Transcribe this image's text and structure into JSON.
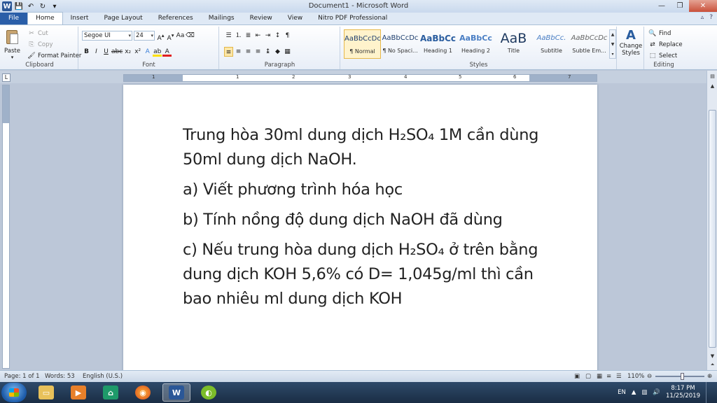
{
  "window": {
    "title": "Document1 - Microsoft Word"
  },
  "tabs": [
    "File",
    "Home",
    "Insert",
    "Page Layout",
    "References",
    "Mailings",
    "Review",
    "View",
    "Nitro PDF Professional"
  ],
  "clipboard": {
    "paste": "Paste",
    "cut": "Cut",
    "copy": "Copy",
    "format_painter": "Format Painter",
    "label": "Clipboard"
  },
  "font": {
    "family": "Segoe UI",
    "size": "24",
    "label": "Font"
  },
  "paragraph": {
    "label": "Paragraph"
  },
  "styles": {
    "items": [
      {
        "sample": "AaBbCcDc",
        "name": "¶ Normal"
      },
      {
        "sample": "AaBbCcDc",
        "name": "¶ No Spaci..."
      },
      {
        "sample": "AaBbCc",
        "name": "Heading 1"
      },
      {
        "sample": "AaBbCc",
        "name": "Heading 2"
      },
      {
        "sample": "AaB",
        "name": "Title"
      },
      {
        "sample": "AaBbCc.",
        "name": "Subtitle"
      },
      {
        "sample": "AaBbCcDc",
        "name": "Subtle Em..."
      }
    ],
    "change_styles_1": "Change",
    "change_styles_2": "Styles",
    "label": "Styles"
  },
  "editing": {
    "find": "Find",
    "replace": "Replace",
    "select": "Select",
    "label": "Editing"
  },
  "ruler_numbers": [
    "1",
    "1",
    "2",
    "3",
    "4",
    "5",
    "6",
    "7"
  ],
  "document": {
    "p1": "Trung hòa 30ml dung dịch H₂SO₄ 1M cần dùng 50ml dung dịch NaOH.",
    "p2": "a) Viết phương trình hóa học",
    "p3": "b) Tính nồng độ dung dịch NaOH đã dùng",
    "p4": "c) Nếu trung hòa dung dịch H₂SO₄ ở trên bằng dung dịch KOH 5,6% có D= 1,045g/ml thì cần bao nhiêu ml dung dịch KOH"
  },
  "status": {
    "page": "Page: 1 of 1",
    "words": "Words: 53",
    "language": "English (U.S.)",
    "zoom": "110%"
  },
  "taskbar": {
    "lang": "EN",
    "time": "8:17 PM",
    "date": "11/25/2019"
  }
}
